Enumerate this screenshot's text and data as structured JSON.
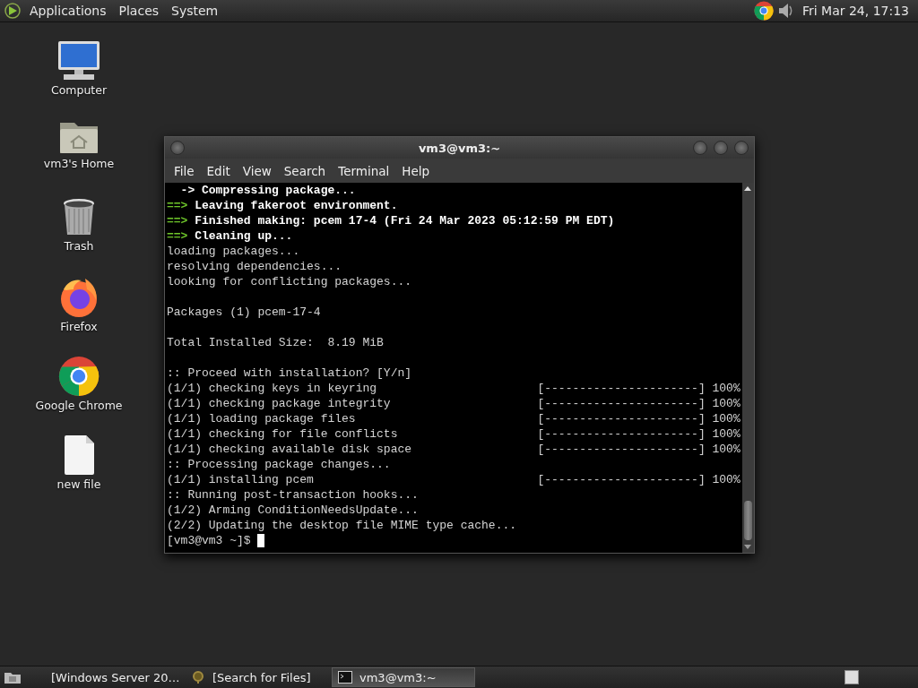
{
  "top_panel": {
    "menus": [
      "Applications",
      "Places",
      "System"
    ],
    "clock": "Fri Mar 24, 17:13"
  },
  "desktop_icons": [
    {
      "kind": "computer",
      "label": "Computer"
    },
    {
      "kind": "home",
      "label": "vm3's Home"
    },
    {
      "kind": "trash",
      "label": "Trash"
    },
    {
      "kind": "firefox",
      "label": "Firefox"
    },
    {
      "kind": "chrome",
      "label": "Google Chrome"
    },
    {
      "kind": "file",
      "label": "new file"
    }
  ],
  "terminal": {
    "title": "vm3@vm3:~",
    "menu": [
      "File",
      "Edit",
      "View",
      "Search",
      "Terminal",
      "Help"
    ],
    "lines": [
      {
        "kind": "bold",
        "text": "  -> Compressing package..."
      },
      {
        "kind": "arrow",
        "prefix": "==>",
        "text": " Leaving fakeroot environment."
      },
      {
        "kind": "arrow",
        "prefix": "==>",
        "text": " Finished making: pcem 17-4 (Fri 24 Mar 2023 05:12:59 PM EDT)"
      },
      {
        "kind": "arrow",
        "prefix": "==>",
        "text": " Cleaning up..."
      },
      {
        "kind": "plain",
        "text": "loading packages..."
      },
      {
        "kind": "plain",
        "text": "resolving dependencies..."
      },
      {
        "kind": "plain",
        "text": "looking for conflicting packages..."
      },
      {
        "kind": "blank"
      },
      {
        "kind": "plain",
        "text": "Packages (1) pcem-17-4"
      },
      {
        "kind": "blank"
      },
      {
        "kind": "plain",
        "text": "Total Installed Size:  8.19 MiB"
      },
      {
        "kind": "blank"
      },
      {
        "kind": "plain",
        "text": ":: Proceed with installation? [Y/n]"
      },
      {
        "kind": "progress",
        "text": "(1/1) checking keys in keyring",
        "bar": "[----------------------]",
        "percent": "100%"
      },
      {
        "kind": "progress",
        "text": "(1/1) checking package integrity",
        "bar": "[----------------------]",
        "percent": "100%"
      },
      {
        "kind": "progress",
        "text": "(1/1) loading package files",
        "bar": "[----------------------]",
        "percent": "100%"
      },
      {
        "kind": "progress",
        "text": "(1/1) checking for file conflicts",
        "bar": "[----------------------]",
        "percent": "100%"
      },
      {
        "kind": "progress",
        "text": "(1/1) checking available disk space",
        "bar": "[----------------------]",
        "percent": "100%"
      },
      {
        "kind": "plain",
        "text": ":: Processing package changes..."
      },
      {
        "kind": "progress",
        "text": "(1/1) installing pcem",
        "bar": "[----------------------]",
        "percent": "100%"
      },
      {
        "kind": "plain",
        "text": ":: Running post-transaction hooks..."
      },
      {
        "kind": "plain",
        "text": "(1/2) Arming ConditionNeedsUpdate..."
      },
      {
        "kind": "plain",
        "text": "(2/2) Updating the desktop file MIME type cache..."
      },
      {
        "kind": "prompt",
        "text": "[vm3@vm3 ~]$ "
      }
    ]
  },
  "taskbar": {
    "tasks": [
      {
        "kind": "chrome",
        "label": "[Windows Server 20…",
        "selected": false
      },
      {
        "kind": "search",
        "label": "[Search for Files]",
        "selected": false
      },
      {
        "kind": "terminal",
        "label": "vm3@vm3:~",
        "selected": true
      }
    ]
  }
}
